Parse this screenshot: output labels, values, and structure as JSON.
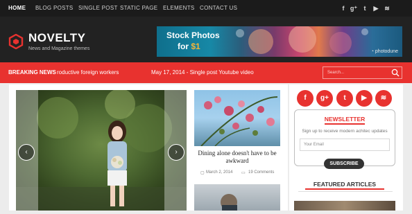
{
  "nav": {
    "items": [
      {
        "label": "HOME",
        "active": true
      },
      {
        "label": "BLOG POSTS"
      },
      {
        "label": "SINGLE POST"
      },
      {
        "label": "STATIC PAGE"
      },
      {
        "label": "ELEMENTS"
      },
      {
        "label": "CONTACT US"
      }
    ],
    "social": [
      {
        "icon": "facebook-icon",
        "glyph": "f"
      },
      {
        "icon": "google-plus-icon",
        "glyph": "g⁺"
      },
      {
        "icon": "twitter-icon",
        "glyph": "t"
      },
      {
        "icon": "youtube-icon",
        "glyph": "▶"
      },
      {
        "icon": "rss-icon",
        "glyph": "≋"
      }
    ]
  },
  "header": {
    "brand": "NOVELTY",
    "tagline": "News and Magazine themes",
    "banner": {
      "line1": "Stock Photos",
      "line2_prefix": "for ",
      "price": "$1",
      "watermark": "◔ photodune"
    }
  },
  "ticker": {
    "label": "BREAKING NEWS",
    "item1": "roductive foreign workers",
    "item2": "May 17, 2014 - Single post Youtube video"
  },
  "search": {
    "placeholder": "Search..."
  },
  "slider": {
    "prev": "‹",
    "next": "›"
  },
  "card": {
    "title": "Dining alone doesn't have to be awkward",
    "date": "March 2, 2014",
    "comments": "19 Comments"
  },
  "sidebar": {
    "social": [
      {
        "icon": "facebook-icon",
        "glyph": "f"
      },
      {
        "icon": "google-plus-icon",
        "glyph": "g+"
      },
      {
        "icon": "twitter-icon",
        "glyph": "t"
      },
      {
        "icon": "youtube-icon",
        "glyph": "▶"
      },
      {
        "icon": "rss-icon",
        "glyph": "≋"
      }
    ],
    "newsletter": {
      "title": "NEWSLETTER",
      "description": "Sign up to receive modern achitec updates",
      "placeholder": "Your Email",
      "button": "SUBSCRIBE"
    },
    "featured_title": "FEATURED ARTICLES"
  },
  "colors": {
    "accent": "#e8322f",
    "dark": "#222222",
    "topbar": "#1b1b1b"
  }
}
